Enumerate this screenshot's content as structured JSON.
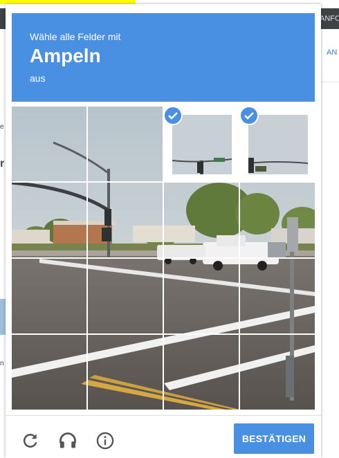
{
  "background_page": {
    "top_right_label": "ANFO",
    "right_link": "AN",
    "left_fragments": [
      "e",
      "r",
      "n"
    ]
  },
  "challenge": {
    "instruction_line1": "Wähle alle Felder mit",
    "target_object": "Ampeln",
    "instruction_line3": "aus",
    "tiles": [
      {
        "id": "r1c1",
        "selected": false
      },
      {
        "id": "r1c2",
        "selected": false
      },
      {
        "id": "r1c3",
        "selected": true
      },
      {
        "id": "r1c4",
        "selected": true
      },
      {
        "id": "r2c1",
        "selected": false
      },
      {
        "id": "r2c2",
        "selected": false
      },
      {
        "id": "r2c3",
        "selected": false
      },
      {
        "id": "r2c4",
        "selected": false
      },
      {
        "id": "r3c1",
        "selected": false
      },
      {
        "id": "r3c2",
        "selected": false
      },
      {
        "id": "r3c3",
        "selected": false
      },
      {
        "id": "r3c4",
        "selected": false
      },
      {
        "id": "r4c1",
        "selected": false
      },
      {
        "id": "r4c2",
        "selected": false
      },
      {
        "id": "r4c3",
        "selected": false
      },
      {
        "id": "r4c4",
        "selected": false
      }
    ]
  },
  "footer": {
    "reload_icon": "reload-icon",
    "audio_icon": "headphones-icon",
    "info_icon": "info-icon",
    "verify_label": "BESTÄTIGEN"
  },
  "colors": {
    "accent": "#4a90e2",
    "sky": "#c9d3d9",
    "road": "#5e5a56"
  }
}
